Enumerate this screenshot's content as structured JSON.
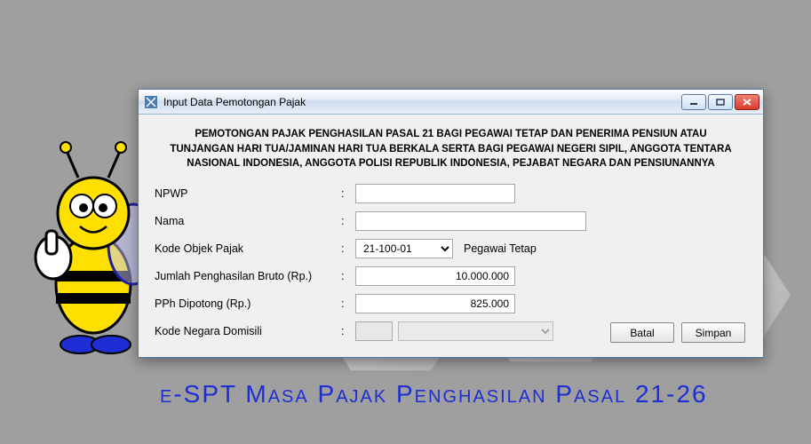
{
  "app": {
    "footer_title": "e-SPT Masa Pajak Penghasilan Pasal 21-26"
  },
  "dialog": {
    "title": "Input Data Pemotongan Pajak",
    "header": "PEMOTONGAN PAJAK PENGHASILAN PASAL 21 BAGI PEGAWAI TETAP DAN PENERIMA PENSIUN ATAU TUNJANGAN HARI TUA/JAMINAN HARI TUA BERKALA SERTA BAGI PEGAWAI NEGERI SIPIL, ANGGOTA TENTARA NASIONAL INDONESIA, ANGGOTA POLISI REPUBLIK INDONESIA, PEJABAT NEGARA DAN PENSIUNANNYA",
    "fields": {
      "npwp": {
        "label": "NPWP",
        "value": ""
      },
      "nama": {
        "label": "Nama",
        "value": ""
      },
      "kode_objek": {
        "label": "Kode Objek Pajak",
        "value": "21-100-01",
        "hint": "Pegawai Tetap"
      },
      "bruto": {
        "label": "Jumlah Penghasilan Bruto (Rp.)",
        "value": "10.000.000"
      },
      "pph": {
        "label": "PPh Dipotong (Rp.)",
        "value": "825.000"
      },
      "domisili": {
        "label": "Kode Negara Domisili",
        "value": ""
      }
    },
    "buttons": {
      "cancel": "Batal",
      "save": "Simpan"
    }
  }
}
